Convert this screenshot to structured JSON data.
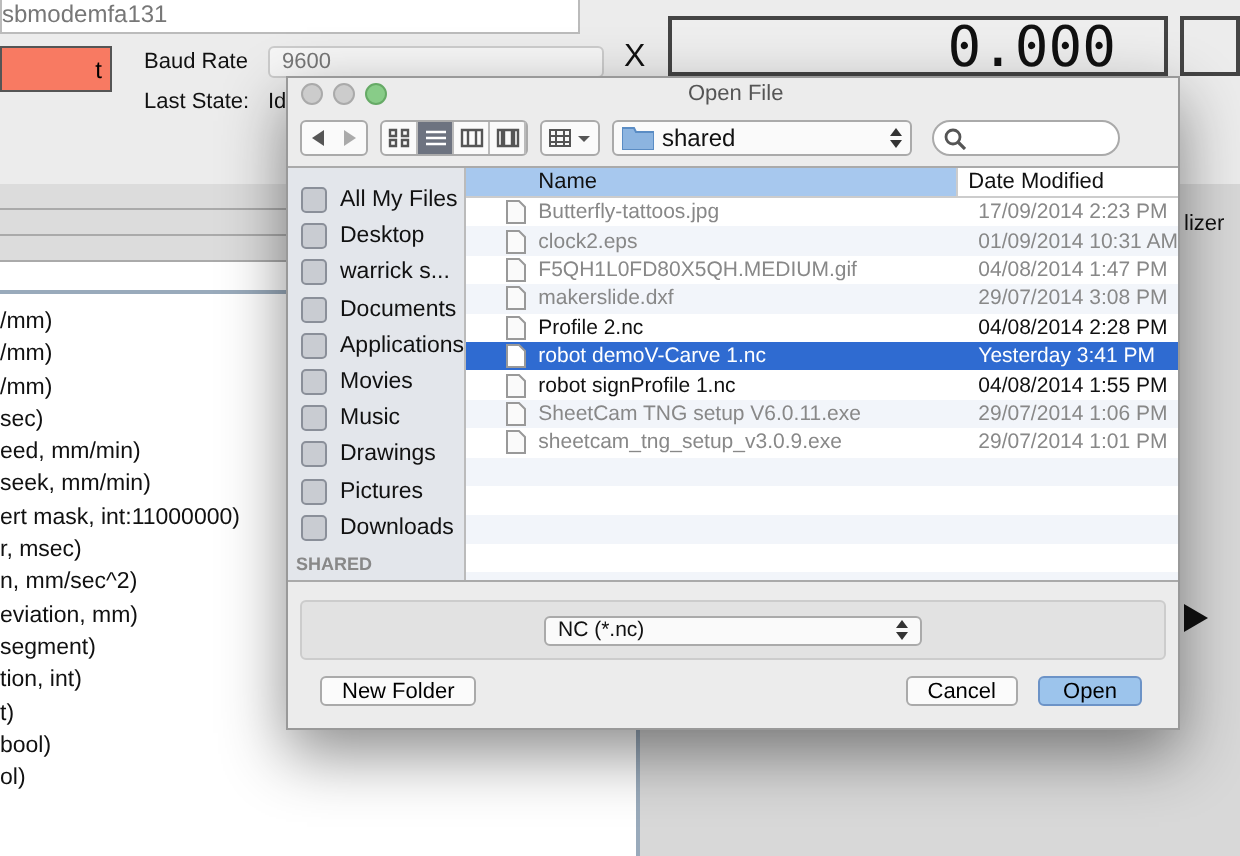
{
  "app": {
    "port_field": "sbmodemfa131",
    "connect_button": "t",
    "baud_label": "Baud Rate",
    "baud_value": "9600",
    "state_label": "Last State:",
    "state_value": "Id",
    "axis_label": "X",
    "coordinate": "0.000",
    "tab_fragment": "lizer",
    "settings_lines": [
      "/mm)",
      "/mm)",
      "/mm)",
      "sec)",
      "eed, mm/min)",
      "seek, mm/min)",
      "ert mask, int:11000000)",
      "r, msec)",
      "n, mm/sec^2)",
      "eviation, mm)",
      "segment)",
      "tion, int)",
      "t)",
      "bool)",
      "ol)"
    ]
  },
  "dialog": {
    "title": "Open File",
    "location": "shared",
    "views": [
      {
        "selected": false
      },
      {
        "selected": true
      },
      {
        "selected": false
      },
      {
        "selected": false
      }
    ],
    "sidebar": {
      "items": [
        {
          "label": "All My Files"
        },
        {
          "label": "Desktop"
        },
        {
          "label": "warrick s..."
        },
        {
          "label": "Documents"
        },
        {
          "label": "Applications"
        },
        {
          "label": "Movies"
        },
        {
          "label": "Music"
        },
        {
          "label": "Drawings"
        },
        {
          "label": "Pictures"
        },
        {
          "label": "Downloads"
        }
      ],
      "section": "SHARED"
    },
    "columns": [
      "Name",
      "Date Modified"
    ],
    "files": [
      {
        "name": "Butterfly-tattoos.jpg",
        "date": "17/09/2014 2:23 PM",
        "disabled": true,
        "selected": false
      },
      {
        "name": "clock2.eps",
        "date": "01/09/2014 10:31 AM",
        "disabled": true,
        "selected": false
      },
      {
        "name": "F5QH1L0FD80X5QH.MEDIUM.gif",
        "date": "04/08/2014 1:47 PM",
        "disabled": true,
        "selected": false
      },
      {
        "name": "makerslide.dxf",
        "date": "29/07/2014 3:08 PM",
        "disabled": true,
        "selected": false
      },
      {
        "name": "Profile 2.nc",
        "date": "04/08/2014 2:28 PM",
        "disabled": false,
        "selected": false
      },
      {
        "name": "robot demoV-Carve 1.nc",
        "date": "Yesterday 3:41 PM",
        "disabled": false,
        "selected": true
      },
      {
        "name": "robot signProfile 1.nc",
        "date": "04/08/2014 1:55 PM",
        "disabled": false,
        "selected": false
      },
      {
        "name": "SheetCam TNG setup V6.0.11.exe",
        "date": "29/07/2014 1:06 PM",
        "disabled": true,
        "selected": false
      },
      {
        "name": "sheetcam_tng_setup_v3.0.9.exe",
        "date": "29/07/2014 1:01 PM",
        "disabled": true,
        "selected": false
      }
    ],
    "filter": "NC (*.nc)",
    "buttons": {
      "new_folder": "New Folder",
      "cancel": "Cancel",
      "open": "Open"
    }
  }
}
